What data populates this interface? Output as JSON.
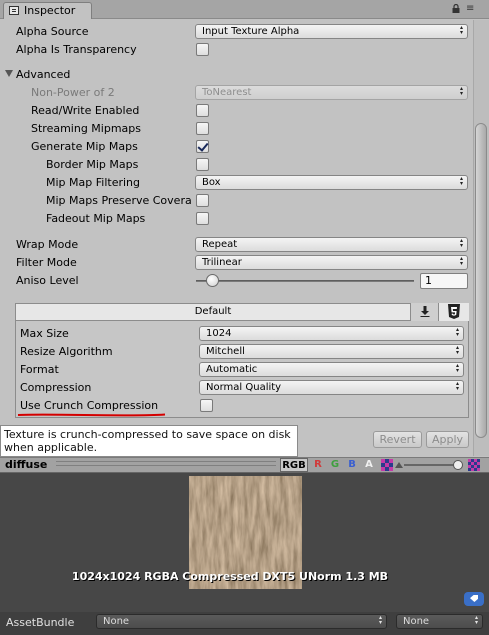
{
  "tab": {
    "title": "Inspector"
  },
  "rows": {
    "alpha_source": {
      "label": "Alpha Source",
      "value": "Input Texture Alpha"
    },
    "alpha_is_transparency": {
      "label": "Alpha Is Transparency",
      "checked": false
    },
    "advanced": {
      "label": "Advanced",
      "expanded": true
    },
    "non_power_of_2": {
      "label": "Non-Power of 2",
      "value": "ToNearest",
      "disabled": true
    },
    "read_write": {
      "label": "Read/Write Enabled",
      "checked": false
    },
    "streaming_mipmaps": {
      "label": "Streaming Mipmaps",
      "checked": false
    },
    "generate_mip_maps": {
      "label": "Generate Mip Maps",
      "checked": true
    },
    "border_mip_maps": {
      "label": "Border Mip Maps",
      "checked": false
    },
    "mip_map_filtering": {
      "label": "Mip Map Filtering",
      "value": "Box"
    },
    "mip_maps_preserve_coverage": {
      "label": "Mip Maps Preserve Covera",
      "checked": false
    },
    "fadeout_mip_maps": {
      "label": "Fadeout Mip Maps",
      "checked": false
    },
    "wrap_mode": {
      "label": "Wrap Mode",
      "value": "Repeat"
    },
    "filter_mode": {
      "label": "Filter Mode",
      "value": "Trilinear"
    },
    "aniso_level": {
      "label": "Aniso Level",
      "value": "1"
    }
  },
  "platform": {
    "tab_label": "Default",
    "max_size": {
      "label": "Max Size",
      "value": "1024"
    },
    "resize_algorithm": {
      "label": "Resize Algorithm",
      "value": "Mitchell"
    },
    "format": {
      "label": "Format",
      "value": "Automatic"
    },
    "compression": {
      "label": "Compression",
      "value": "Normal Quality"
    },
    "use_crunch": {
      "label": "Use Crunch Compression",
      "checked": false
    }
  },
  "buttons": {
    "revert": "Revert",
    "apply": "Apply"
  },
  "tooltip": {
    "text": "Texture is crunch-compressed to save space on disk when applicable."
  },
  "preview": {
    "title": "diffuse",
    "channels": {
      "rgb": "RGB",
      "r": "R",
      "g": "G",
      "b": "B",
      "a": "A"
    },
    "info": "1024x1024  RGBA Compressed DXT5 UNorm   1.3 MB"
  },
  "asset_bundle": {
    "label": "AssetBundle",
    "name": "None",
    "variant": "None"
  },
  "colors": {
    "underline": "#d40000",
    "channel_r": "#d03a3a",
    "channel_g": "#3fa03f",
    "channel_b": "#3a5fd0",
    "link_blue": "#3a6fc7"
  }
}
